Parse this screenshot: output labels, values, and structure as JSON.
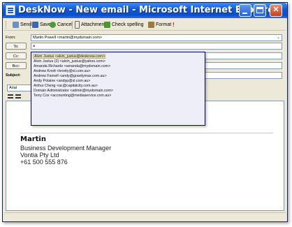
{
  "window": {
    "title": "DeskNow - New email - Microsoft Internet Explorer"
  },
  "toolbar": {
    "send_label": "Send",
    "save_label": "Save",
    "cancel_label": "Cancel",
    "attachments_label": "Attachments",
    "spelling_label": "Check spelling",
    "format_label": "Format",
    "priority_label": "!"
  },
  "form": {
    "from_label": "From:",
    "from_value": "Martin Powell <martin@mydomain.com>",
    "to_label": "To:",
    "to_value": "a",
    "cc_label": "Cc:",
    "bcc_label": "Bcc:",
    "subject_label": "Subject:",
    "font_value": "Arial"
  },
  "autocomplete": {
    "items": [
      "Alvin Justus <alvin_justus@desknow.com>",
      "Alvin Justus (2) <alvin_justus@yahoo.com>",
      "Amanda Richards <amanda@mydomain.com>",
      "Andrew Knott <knotty@sl.com.au>",
      "Andrew Farnell <andy@gravitymax.com.au>",
      "Andy Polaine <andyp@sl.com.au>",
      "Arthur Cheng <ac@capitalcity.com.au>",
      "Domain Administrator <admin@mydomain.com>",
      "Terry Cox <accounting@mediaservice.com.au>"
    ]
  },
  "signature": {
    "name": "Martin",
    "title": "Business Development Manager",
    "company": "Vontia Pty Ltd",
    "phone": "+61 500 555 876"
  },
  "colors": {
    "titlebar": "#0a4fca",
    "chrome": "#ece9d8",
    "popup_bg": "#eeeef9",
    "selection": "#e9e6b4"
  }
}
